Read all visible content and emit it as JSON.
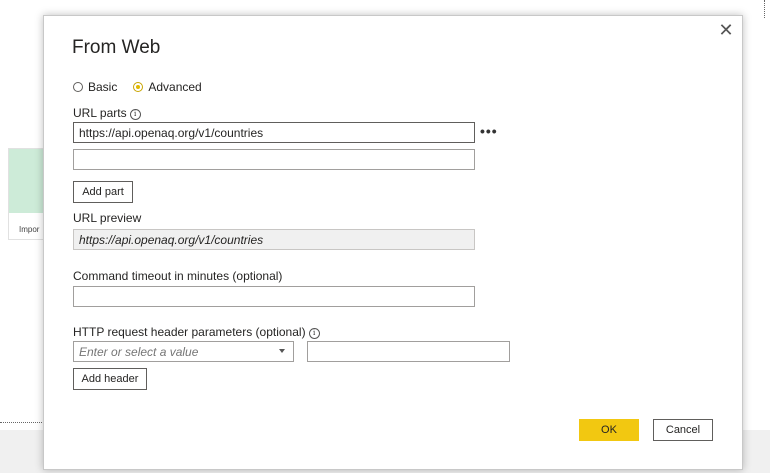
{
  "background": {
    "card_label": "Impor"
  },
  "dialog": {
    "title": "From Web",
    "close_glyph": "✕",
    "mode_options": [
      {
        "label": "Basic",
        "selected": false
      },
      {
        "label": "Advanced",
        "selected": true
      }
    ],
    "url_parts_label": "URL parts",
    "url_parts": [
      "https://api.openaq.org/v1/countries",
      ""
    ],
    "more_options": "•••",
    "add_part_label": "Add part",
    "url_preview_label": "URL preview",
    "url_preview_value": "https://api.openaq.org/v1/countries",
    "timeout_label": "Command timeout in minutes (optional)",
    "timeout_value": "",
    "headers_label": "HTTP request header parameters (optional)",
    "header_select_placeholder": "Enter or select a value",
    "header_value": "",
    "add_header_label": "Add header",
    "ok_label": "OK",
    "cancel_label": "Cancel",
    "info_icon_glyph": "i"
  },
  "colors": {
    "ok_button": "#f2c811",
    "radio_selected": "#e1b900"
  }
}
